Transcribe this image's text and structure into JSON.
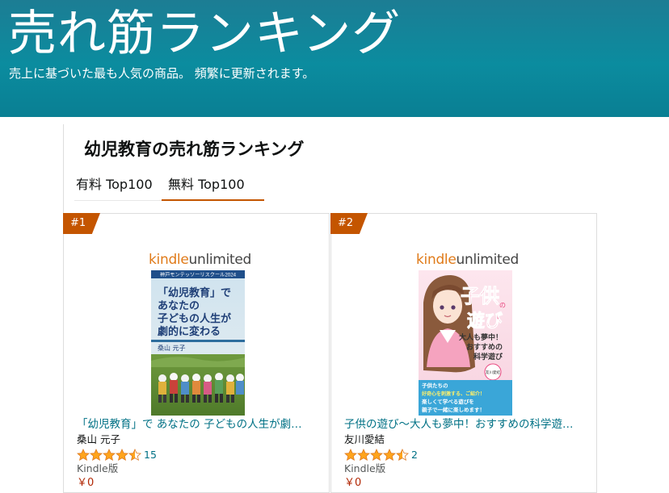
{
  "banner": {
    "title": "売れ筋ランキング",
    "subtitle": "売上に基づいた最も人気の商品。 頻繁に更新されます。"
  },
  "page": {
    "title": "幼児教育の売れ筋ランキング"
  },
  "tabs": [
    {
      "label": "有料 Top100",
      "selected": false
    },
    {
      "label": "無料 Top100",
      "selected": true
    }
  ],
  "colors": {
    "banner": "#0b8c9f",
    "accent": "#c45500",
    "link": "#007185",
    "price": "#b12704",
    "star": "#ffa41c"
  },
  "items": [
    {
      "rank": "#1",
      "logo": {
        "kindle": "kindle",
        "unlimited": "unlimited"
      },
      "cover": {
        "series": "神戸モンテッソーリスクール2024",
        "lines": [
          "「幼児教育」で",
          "あなたの",
          "子どもの人生が",
          "劇的に変わる"
        ],
        "author": "桑山 元子"
      },
      "title": "「幼児教育」で あなたの 子どもの人生が劇…",
      "author": "桑山 元子",
      "rating": 4.5,
      "review_count": "15",
      "format": "Kindle版",
      "price": "￥0"
    },
    {
      "rank": "#2",
      "logo": {
        "kindle": "kindle",
        "unlimited": "unlimited"
      },
      "cover": {
        "big": [
          "子供",
          "の",
          "遊び"
        ],
        "lines": [
          "大人も夢中！",
          "おすすめの",
          "科学遊び"
        ],
        "author": "友川愛結",
        "bottom": [
          "子供たちの",
          "好奇心を刺激する、ご紹介！",
          "楽しくて学べる遊びを",
          "親子で一緒に楽しめます！"
        ]
      },
      "title": "子供の遊び～大人も夢中！おすすめの科学遊…",
      "author": "友川愛結",
      "rating": 4.5,
      "review_count": "2",
      "format": "Kindle版",
      "price": "￥0"
    }
  ]
}
